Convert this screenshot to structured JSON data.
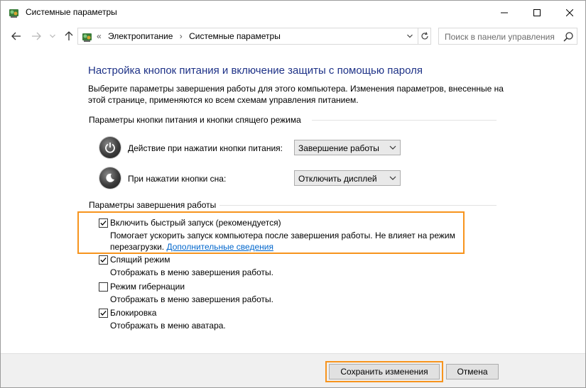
{
  "window": {
    "title": "Системные параметры",
    "title_icon": "control-panel-icon"
  },
  "nav": {
    "back_icon": "arrow-left-icon",
    "forward_icon": "arrow-right-icon",
    "recent_icon": "chevron-down-icon",
    "up_icon": "arrow-up-icon"
  },
  "address": {
    "crumbs": [
      "«",
      "Электропитание",
      "›",
      "Системные параметры"
    ],
    "refresh_icon": "refresh-icon"
  },
  "search": {
    "placeholder": "Поиск в панели управления"
  },
  "page": {
    "title": "Настройка кнопок питания и включение защиты с помощью пароля",
    "description": "Выберите параметры завершения работы для этого компьютера. Изменения параметров, внесенные на этой странице, применяются ко всем схемам управления питанием."
  },
  "buttons_group": {
    "header": "Параметры кнопки питания и кнопки спящего режима",
    "power_label": "Действие при нажатии кнопки питания:",
    "power_value": "Завершение работы",
    "sleep_label": "При нажатии кнопки сна:",
    "sleep_value": "Отключить дисплей"
  },
  "shutdown_group": {
    "header": "Параметры завершения работы",
    "options": [
      {
        "label": "Включить быстрый запуск (рекомендуется)",
        "checked": true,
        "desc_line1": "Помогает ускорить запуск компьютера после завершения работы. Не влияет на режим",
        "desc_line2": "перезагрузки.",
        "link": "Дополнительные сведения"
      },
      {
        "label": "Спящий режим",
        "checked": true,
        "desc_line1": "Отображать в меню завершения работы."
      },
      {
        "label": "Режим гибернации",
        "checked": false,
        "desc_line1": "Отображать в меню завершения работы."
      },
      {
        "label": "Блокировка",
        "checked": true,
        "desc_line1": "Отображать в меню аватара."
      }
    ]
  },
  "footer": {
    "save_label": "Сохранить изменения",
    "cancel_label": "Отмена"
  },
  "colors": {
    "title_blue": "#1e3287",
    "link_blue": "#0066cc",
    "highlight_orange": "#f7941d"
  }
}
